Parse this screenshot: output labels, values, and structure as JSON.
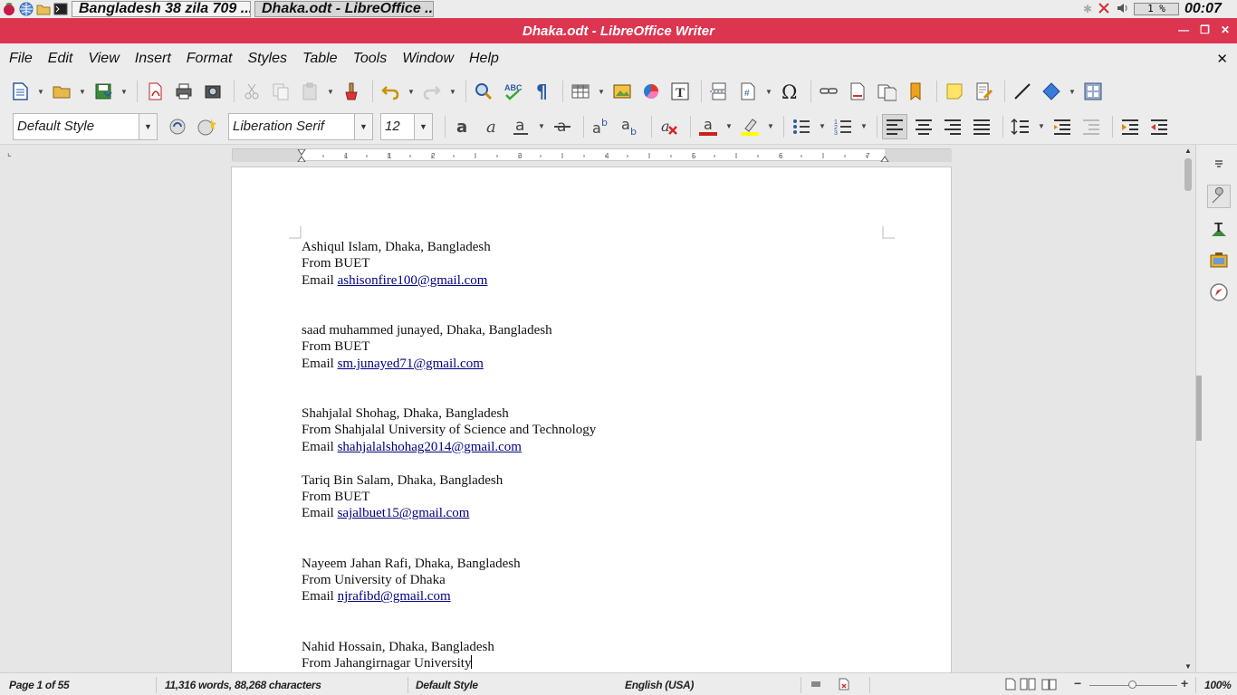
{
  "taskbar": {
    "tasks": [
      {
        "label": "Bangladesh 38 zila 709 ..."
      },
      {
        "label": "Dhaka.odt - LibreOffice ..."
      }
    ],
    "cpu_label": "1 %",
    "clock": "00:07"
  },
  "window": {
    "title": "Dhaka.odt - LibreOffice Writer"
  },
  "menu": {
    "items": [
      "File",
      "Edit",
      "View",
      "Insert",
      "Format",
      "Styles",
      "Table",
      "Tools",
      "Window",
      "Help"
    ],
    "close": "✕"
  },
  "formatting": {
    "paragraph_style": "Default Style",
    "font_name": "Liberation Serif",
    "font_size": "12"
  },
  "document": {
    "entries": [
      {
        "name": "Ashiqul Islam, Dhaka, Bangladesh",
        "from": "From BUET",
        "email_prefix": "Email ",
        "email": "ashisonfire100@gmail.com"
      },
      {
        "name": "saad muhammed junayed, Dhaka, Bangladesh",
        "from": "From BUET",
        "email_prefix": "Email ",
        "email": "sm.junayed71@gmail.com"
      },
      {
        "name": "Shahjalal Shohag, Dhaka, Bangladesh",
        "from": "From Shahjalal University of Science and Technology",
        "email_prefix": "Email ",
        "email": "shahjalalshohag2014@gmail.com"
      },
      {
        "name": "Tariq Bin Salam, Dhaka, Bangladesh",
        "from": "From BUET",
        "email_prefix": "Email ",
        "email": "sajalbuet15@gmail.com"
      },
      {
        "name": "Nayeem Jahan Rafi, Dhaka, Bangladesh",
        "from": "From University of Dhaka",
        "email_prefix": "Email ",
        "email": "njrafibd@gmail.com"
      },
      {
        "name": "Nahid Hossain, Dhaka, Bangladesh",
        "from": "From Jahangirnagar University"
      }
    ]
  },
  "statusbar": {
    "page": "Page 1 of 55",
    "words": "11,316 words, 88,268 characters",
    "style": "Default Style",
    "language": "English (USA)",
    "zoom": "100%"
  },
  "colors": {
    "title_bar": "#dc3550",
    "link": "#000080"
  }
}
